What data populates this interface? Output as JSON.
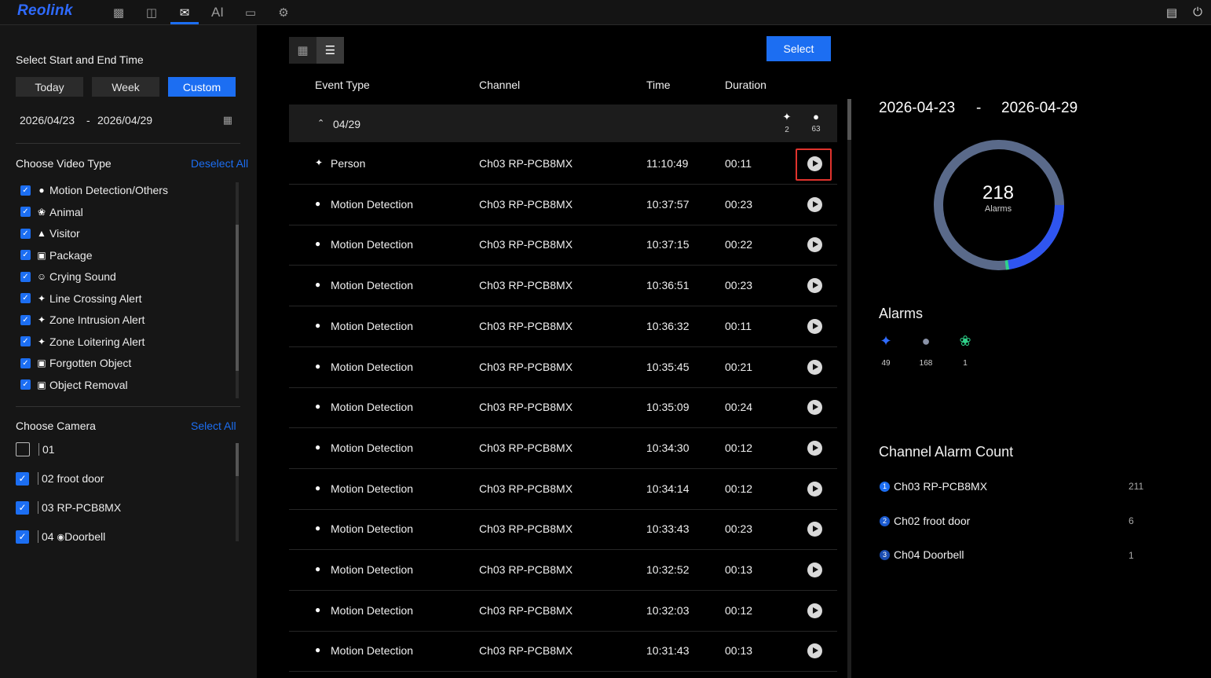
{
  "app": {
    "brand": "Reolink",
    "nav_ai": "AI"
  },
  "filters": {
    "time_title": "Select Start and End Time",
    "ranges": [
      "Today",
      "Week",
      "Custom"
    ],
    "active_range": "Custom",
    "start_date": "2026/04/23",
    "date_sep": "-",
    "end_date": "2026/04/29",
    "video_type_title": "Choose Video Type",
    "deselect_all": "Deselect All",
    "video_types": [
      {
        "label": "Motion Detection/Others",
        "icon": "motion-icon",
        "checked": true
      },
      {
        "label": "Animal",
        "icon": "paw-icon",
        "checked": true
      },
      {
        "label": "Visitor",
        "icon": "bell-icon",
        "checked": true
      },
      {
        "label": "Package",
        "icon": "package-icon",
        "checked": true
      },
      {
        "label": "Crying Sound",
        "icon": "baby-icon",
        "checked": true
      },
      {
        "label": "Line Crossing Alert",
        "icon": "line-crossing-icon",
        "checked": true
      },
      {
        "label": "Zone Intrusion Alert",
        "icon": "zone-intrusion-icon",
        "checked": true
      },
      {
        "label": "Zone Loitering Alert",
        "icon": "zone-loitering-icon",
        "checked": true
      },
      {
        "label": "Forgotten Object",
        "icon": "forgotten-object-icon",
        "checked": true
      },
      {
        "label": "Object Removal",
        "icon": "object-removal-icon",
        "checked": true
      }
    ],
    "camera_title": "Choose Camera",
    "select_all": "Select All",
    "cameras": [
      {
        "num": "01",
        "name": "",
        "checked": false
      },
      {
        "num": "02",
        "name": "froot door",
        "checked": true
      },
      {
        "num": "03",
        "name": "RP-PCB8MX",
        "checked": true
      },
      {
        "num": "04",
        "name": "Doorbell",
        "checked": true,
        "icon": "doorbell-icon"
      }
    ]
  },
  "list": {
    "select_label": "Select",
    "headers": {
      "event_type": "Event Type",
      "channel": "Channel",
      "time": "Time",
      "duration": "Duration"
    },
    "group": {
      "label": "04/29",
      "person_count": "2",
      "motion_count": "63"
    },
    "rows": [
      {
        "type": "Person",
        "icon": "person-icon",
        "channel": "Ch03 RP-PCB8MX",
        "time": "11:10:49",
        "duration": "00:11"
      },
      {
        "type": "Motion Detection",
        "icon": "motion-icon",
        "channel": "Ch03 RP-PCB8MX",
        "time": "10:37:57",
        "duration": "00:23"
      },
      {
        "type": "Motion Detection",
        "icon": "motion-icon",
        "channel": "Ch03 RP-PCB8MX",
        "time": "10:37:15",
        "duration": "00:22"
      },
      {
        "type": "Motion Detection",
        "icon": "motion-icon",
        "channel": "Ch03 RP-PCB8MX",
        "time": "10:36:51",
        "duration": "00:23"
      },
      {
        "type": "Motion Detection",
        "icon": "motion-icon",
        "channel": "Ch03 RP-PCB8MX",
        "time": "10:36:32",
        "duration": "00:11"
      },
      {
        "type": "Motion Detection",
        "icon": "motion-icon",
        "channel": "Ch03 RP-PCB8MX",
        "time": "10:35:45",
        "duration": "00:21"
      },
      {
        "type": "Motion Detection",
        "icon": "motion-icon",
        "channel": "Ch03 RP-PCB8MX",
        "time": "10:35:09",
        "duration": "00:24"
      },
      {
        "type": "Motion Detection",
        "icon": "motion-icon",
        "channel": "Ch03 RP-PCB8MX",
        "time": "10:34:30",
        "duration": "00:12"
      },
      {
        "type": "Motion Detection",
        "icon": "motion-icon",
        "channel": "Ch03 RP-PCB8MX",
        "time": "10:34:14",
        "duration": "00:12"
      },
      {
        "type": "Motion Detection",
        "icon": "motion-icon",
        "channel": "Ch03 RP-PCB8MX",
        "time": "10:33:43",
        "duration": "00:23"
      },
      {
        "type": "Motion Detection",
        "icon": "motion-icon",
        "channel": "Ch03 RP-PCB8MX",
        "time": "10:32:52",
        "duration": "00:13"
      },
      {
        "type": "Motion Detection",
        "icon": "motion-icon",
        "channel": "Ch03 RP-PCB8MX",
        "time": "10:32:03",
        "duration": "00:12"
      },
      {
        "type": "Motion Detection",
        "icon": "motion-icon",
        "channel": "Ch03 RP-PCB8MX",
        "time": "10:31:43",
        "duration": "00:13"
      }
    ]
  },
  "summary": {
    "start": "2026-04-23",
    "dash": "-",
    "end": "2026-04-29",
    "total": "218",
    "total_label": "Alarms",
    "alarms_title": "Alarms",
    "alarm_counts": [
      {
        "icon": "person-icon",
        "count": "49",
        "color": "#2f6bff"
      },
      {
        "icon": "motion-icon",
        "count": "168",
        "color": "#8a93a8"
      },
      {
        "icon": "paw-icon",
        "count": "1",
        "color": "#2fd38b"
      }
    ],
    "channel_title": "Channel Alarm Count",
    "channels": [
      {
        "rank": "1",
        "name": "Ch03 RP-PCB8MX",
        "count": "211"
      },
      {
        "rank": "2",
        "name": "Ch02 froot door",
        "count": "6"
      },
      {
        "rank": "3",
        "name": "Ch04 Doorbell",
        "count": "1"
      }
    ],
    "colors": {
      "person": "#2f55f0",
      "motion": "#5f6f8c",
      "animal": "#2fd38b"
    }
  }
}
